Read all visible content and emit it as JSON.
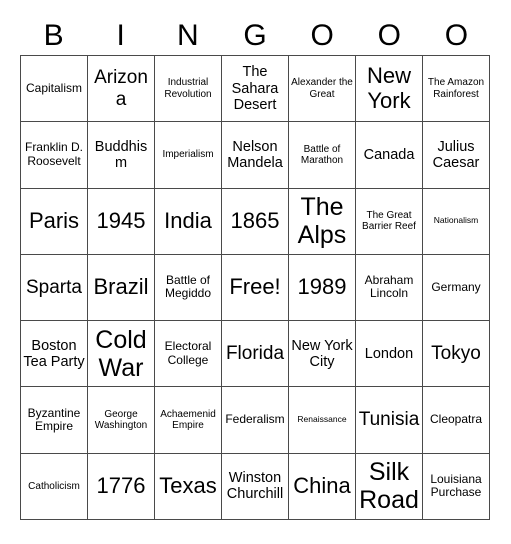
{
  "header": {
    "letters": [
      "B",
      "I",
      "N",
      "G",
      "O",
      "O",
      "O"
    ]
  },
  "grid": {
    "columns": 7,
    "rows": 7,
    "cells": [
      {
        "text": "Capitalism",
        "size": "fs-sm"
      },
      {
        "text": "Arizona",
        "size": "fs-lg"
      },
      {
        "text": "Industrial Revolution",
        "size": "fs-xs"
      },
      {
        "text": "The Sahara Desert",
        "size": "fs-md"
      },
      {
        "text": "Alexander the Great",
        "size": "fs-xs"
      },
      {
        "text": "New York",
        "size": "fs-xl"
      },
      {
        "text": "The Amazon Rainforest",
        "size": "fs-xs"
      },
      {
        "text": "Franklin D. Roosevelt",
        "size": "fs-sm"
      },
      {
        "text": "Buddhism",
        "size": "fs-md"
      },
      {
        "text": "Imperialism",
        "size": "fs-xs"
      },
      {
        "text": "Nelson Mandela",
        "size": "fs-md"
      },
      {
        "text": "Battle of Marathon",
        "size": "fs-xs"
      },
      {
        "text": "Canada",
        "size": "fs-md"
      },
      {
        "text": "Julius Caesar",
        "size": "fs-md"
      },
      {
        "text": "Paris",
        "size": "fs-xl"
      },
      {
        "text": "1945",
        "size": "fs-xl"
      },
      {
        "text": "India",
        "size": "fs-xl"
      },
      {
        "text": "1865",
        "size": "fs-xl"
      },
      {
        "text": "The Alps",
        "size": "fs-xxl"
      },
      {
        "text": "The Great Barrier Reef",
        "size": "fs-xs"
      },
      {
        "text": "Nationalism",
        "size": "fs-xxs"
      },
      {
        "text": "Sparta",
        "size": "fs-lg"
      },
      {
        "text": "Brazil",
        "size": "fs-xl"
      },
      {
        "text": "Battle of Megiddo",
        "size": "fs-sm"
      },
      {
        "text": "Free!",
        "size": "fs-xl"
      },
      {
        "text": "1989",
        "size": "fs-xl"
      },
      {
        "text": "Abraham Lincoln",
        "size": "fs-sm"
      },
      {
        "text": "Germany",
        "size": "fs-sm"
      },
      {
        "text": "Boston Tea Party",
        "size": "fs-md"
      },
      {
        "text": "Cold War",
        "size": "fs-xxl"
      },
      {
        "text": "Electoral College",
        "size": "fs-sm"
      },
      {
        "text": "Florida",
        "size": "fs-lg"
      },
      {
        "text": "New York City",
        "size": "fs-md"
      },
      {
        "text": "London",
        "size": "fs-md"
      },
      {
        "text": "Tokyo",
        "size": "fs-lg"
      },
      {
        "text": "Byzantine Empire",
        "size": "fs-sm"
      },
      {
        "text": "George Washington",
        "size": "fs-xs"
      },
      {
        "text": "Achaemenid Empire",
        "size": "fs-xs"
      },
      {
        "text": "Federalism",
        "size": "fs-sm"
      },
      {
        "text": "Renaissance",
        "size": "fs-xxs"
      },
      {
        "text": "Tunisia",
        "size": "fs-lg"
      },
      {
        "text": "Cleopatra",
        "size": "fs-sm"
      },
      {
        "text": "Catholicism",
        "size": "fs-xs"
      },
      {
        "text": "1776",
        "size": "fs-xl"
      },
      {
        "text": "Texas",
        "size": "fs-xl"
      },
      {
        "text": "Winston Churchill",
        "size": "fs-md"
      },
      {
        "text": "China",
        "size": "fs-xl"
      },
      {
        "text": "Silk Road",
        "size": "fs-xxl"
      },
      {
        "text": "Louisiana Purchase",
        "size": "fs-sm"
      }
    ]
  }
}
